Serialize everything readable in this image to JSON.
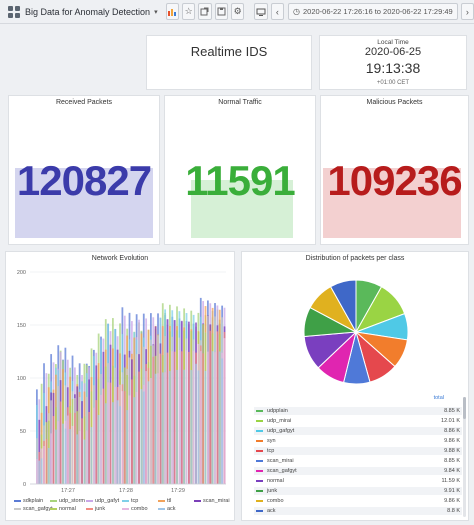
{
  "topbar": {
    "dashboard_title": "Big Data for Anomaly Detection",
    "caret": "▾",
    "icons": [
      "bar-chart-add-icon",
      "star-icon",
      "share-icon",
      "save-icon",
      "settings-icon",
      "tv-mode-icon",
      "time-back-icon"
    ],
    "time_range": "2020-06-22 17:26:16 to 2020-06-22 17:29:49",
    "time_forward": "›"
  },
  "ids_panel": {
    "title": "Realtime IDS"
  },
  "local_time": {
    "label": "Local Time",
    "date": "2020-06-25",
    "time": "19:13:38",
    "tz": "+01:00 CET"
  },
  "stats": [
    {
      "title": "Received Packets",
      "value": "120827",
      "color": "#3b3baa",
      "fill": "#d4d5ef"
    },
    {
      "title": "Normal Traffic",
      "value": "11591",
      "color": "#3aae3a",
      "fill": "#d6f0d6"
    },
    {
      "title": "Malicious Packets",
      "value": "109236",
      "color": "#b71c1c",
      "fill": "#f3d0d0"
    }
  ],
  "network": {
    "title": "Network Evolution",
    "y_ticks": [
      "200",
      "150",
      "100",
      "50",
      "0"
    ],
    "x_ticks": [
      "17:27",
      "17:28",
      "17:29"
    ],
    "legend": [
      "sdkplain",
      "udp_storm",
      "udp_gafyt",
      "tcp",
      "ttl",
      "scan_mirai",
      "scan_gafgyt",
      "normal",
      "junk",
      "combo",
      "ack"
    ]
  },
  "distribution": {
    "title": "Distribution of packets per class",
    "total_header": "total",
    "rows": [
      {
        "name": "udpplain",
        "total": "8.85 K"
      },
      {
        "name": "udp_mirai",
        "total": "12.01 K"
      },
      {
        "name": "udp_gafgyt",
        "total": "8.86 K"
      },
      {
        "name": "syn",
        "total": "9.86 K"
      },
      {
        "name": "tcp",
        "total": "9.88 K"
      },
      {
        "name": "scan_mirai",
        "total": "8.85 K"
      },
      {
        "name": "scan_gafgyt",
        "total": "9.84 K"
      },
      {
        "name": "normal",
        "total": "11.59 K"
      },
      {
        "name": "junk",
        "total": "9.91 K"
      },
      {
        "name": "combo",
        "total": "9.86 K"
      },
      {
        "name": "ack",
        "total": "8.8 K"
      }
    ]
  },
  "chart_data": [
    {
      "type": "area",
      "title": "Network Evolution",
      "ylim": [
        0,
        200
      ],
      "x": [
        "17:26:40",
        "17:27",
        "17:27:20",
        "17:27:40",
        "17:28",
        "17:28:20",
        "17:28:40",
        "17:29",
        "17:29:20"
      ],
      "series": [
        {
          "name": "udpplain",
          "values": [
            105,
            140,
            120,
            175,
            165,
            175,
            178,
            178,
            178
          ]
        },
        {
          "name": "udp_mirai",
          "values": [
            95,
            135,
            115,
            170,
            160,
            172,
            175,
            176,
            177
          ]
        },
        {
          "name": "udp_gafyt",
          "values": [
            90,
            130,
            110,
            168,
            158,
            170,
            174,
            175,
            176
          ]
        },
        {
          "name": "tcp",
          "values": [
            80,
            125,
            100,
            160,
            150,
            165,
            170,
            172,
            174
          ]
        },
        {
          "name": "ttl",
          "values": [
            70,
            115,
            95,
            150,
            140,
            160,
            168,
            170,
            172
          ]
        },
        {
          "name": "scan_mirai",
          "values": [
            60,
            110,
            90,
            140,
            130,
            155,
            160,
            165,
            170
          ]
        },
        {
          "name": "scan_gafgyt",
          "values": [
            50,
            100,
            85,
            130,
            120,
            150,
            155,
            160,
            165
          ]
        },
        {
          "name": "normal",
          "values": [
            40,
            90,
            75,
            120,
            110,
            140,
            150,
            155,
            160
          ]
        },
        {
          "name": "junk",
          "values": [
            30,
            80,
            65,
            110,
            100,
            130,
            140,
            145,
            150
          ]
        },
        {
          "name": "combo",
          "values": [
            25,
            70,
            55,
            100,
            90,
            120,
            130,
            135,
            140
          ]
        },
        {
          "name": "ack",
          "values": [
            20,
            60,
            45,
            90,
            80,
            110,
            120,
            125,
            130
          ]
        }
      ],
      "colors": [
        "#5b7bd5",
        "#a8d37c",
        "#c9a7e8",
        "#7fd0e8",
        "#f2a25a",
        "#7b3fb8",
        "#c9c9c9",
        "#b3d05f",
        "#f28b82",
        "#e6b8e0",
        "#9fc5e8"
      ],
      "grid": true,
      "legend": "bottom"
    },
    {
      "type": "pie",
      "title": "Distribution of packets per class",
      "categories": [
        "udpplain",
        "udp_mirai",
        "udp_gafgyt",
        "syn",
        "tcp",
        "scan_mirai",
        "scan_gafgyt",
        "normal",
        "junk",
        "combo",
        "ack"
      ],
      "values": [
        8.85,
        12.01,
        8.86,
        9.86,
        9.88,
        8.85,
        9.84,
        11.59,
        9.91,
        9.86,
        8.8
      ],
      "colors": [
        "#5ab95a",
        "#9ad444",
        "#4fc9e6",
        "#f27d2c",
        "#e5484d",
        "#4f79d8",
        "#e025b0",
        "#7a3fbf",
        "#3fa047",
        "#e0b11f",
        "#3f68c8"
      ],
      "legend": "table-bottom"
    }
  ]
}
